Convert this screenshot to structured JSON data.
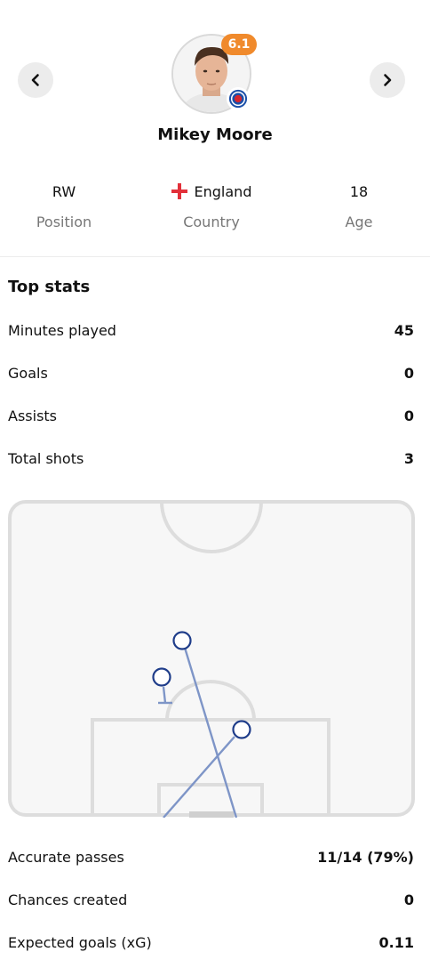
{
  "player": {
    "name": "Mikey Moore",
    "rating": "6.1",
    "rating_color": "#f08a2c",
    "position_value": "RW",
    "position_label": "Position",
    "country_value": "England",
    "country_label": "Country",
    "age_value": "18",
    "age_label": "Age"
  },
  "nav": {
    "prev_icon": "chevron-left-icon",
    "next_icon": "chevron-right-icon"
  },
  "top_stats": {
    "title": "Top stats",
    "rows": [
      {
        "label": "Minutes played",
        "value": "45"
      },
      {
        "label": "Goals",
        "value": "0"
      },
      {
        "label": "Assists",
        "value": "0"
      },
      {
        "label": "Total shots",
        "value": "3"
      }
    ]
  },
  "more_stats": {
    "rows": [
      {
        "label": "Accurate passes",
        "value": "11/14 (79%)"
      },
      {
        "label": "Chances created",
        "value": "0"
      },
      {
        "label": "Expected goals (xG)",
        "value": "0.11"
      }
    ]
  },
  "colors": {
    "shot": "#1f3d8a",
    "pitch_line": "#dddddd",
    "pitch_bg": "#f7f7f7"
  }
}
